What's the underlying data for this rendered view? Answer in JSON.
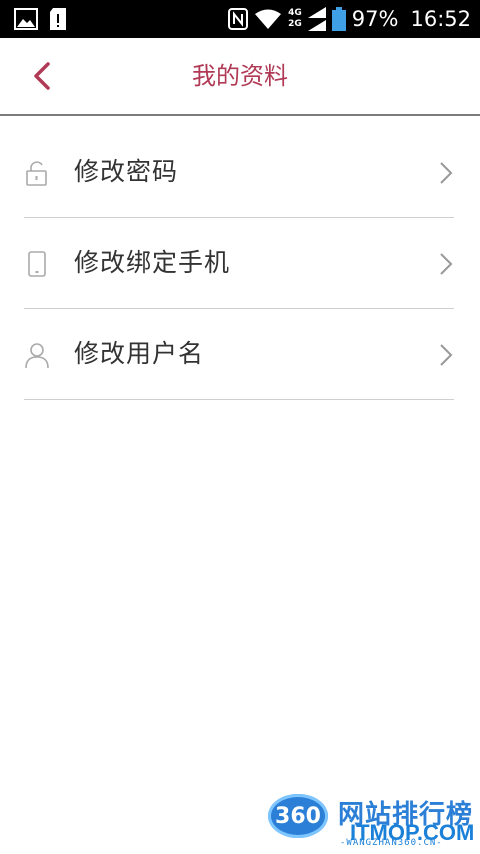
{
  "status_bar": {
    "network_top": "4G",
    "network_bottom": "2G",
    "battery": "97%",
    "time": "16:52"
  },
  "app_bar": {
    "title": "我的资料"
  },
  "menu": {
    "items": [
      {
        "label": "修改密码",
        "icon": "lock-icon"
      },
      {
        "label": "修改绑定手机",
        "icon": "phone-icon"
      },
      {
        "label": "修改用户名",
        "icon": "user-icon"
      }
    ]
  },
  "watermark": {
    "badge": "360",
    "name": "网站排行榜",
    "domain": "ITMOP.COM",
    "sub": "-WANGZHAN360.CN-"
  },
  "colors": {
    "accent": "#b03a55",
    "text": "#333333",
    "divider": "#cfcfcf",
    "icon": "#aaaaaa"
  }
}
